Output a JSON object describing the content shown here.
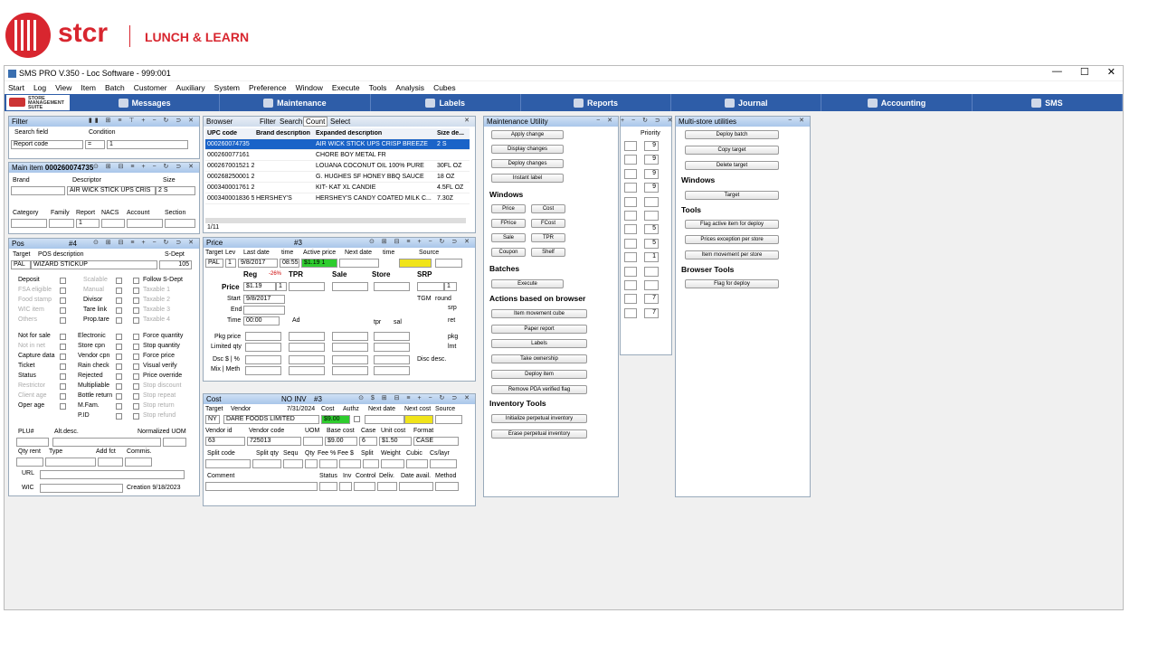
{
  "brand": {
    "name": "stcr",
    "subtitle": "LUNCH & LEARN"
  },
  "window": {
    "title": "SMS PRO V.350 - Loc Software - 999:001",
    "minimize": "—",
    "maximize": "☐",
    "close": "✕"
  },
  "menu": [
    "Start",
    "Log",
    "View",
    "Item",
    "Batch",
    "Customer",
    "Auxiliary",
    "System",
    "Preference",
    "Window",
    "Execute",
    "Tools",
    "Analysis",
    "Cubes"
  ],
  "nav": {
    "logo": "STORE MANAGEMENT SUITE",
    "items": [
      "Messages",
      "Maintenance",
      "Labels",
      "Reports",
      "Journal",
      "Accounting",
      "SMS"
    ]
  },
  "filter": {
    "title": "Filter",
    "search_field_label": "Search field",
    "condition_label": "Condition",
    "search_field": "Report code",
    "operator": "=",
    "value": "1"
  },
  "main_item": {
    "title": "Main item",
    "upc": "000260074735",
    "brand_label": "Brand",
    "descriptor_label": "Descriptor",
    "size_label": "Size",
    "descriptor": "AIR WICK STICK UPS CRIS",
    "size": "2 S",
    "category_label": "Category",
    "family_label": "Family",
    "report_label": "Report",
    "nacs_label": "NACS",
    "account_label": "Account",
    "section_label": "Section",
    "report": "1"
  },
  "pos": {
    "title": "Pos",
    "num": "#4",
    "target_label": "Target",
    "posdesc_label": "POS description",
    "sdept_label": "S-Dept",
    "target": "PAL",
    "desc": "WIZARD STICKUP",
    "sdept": "105",
    "left_labels": [
      "Deposit",
      "FSA eligible",
      "Food stamp",
      "WIC item",
      "Others"
    ],
    "mid_labels": [
      "Scalable",
      "Manual",
      "Divisor",
      "Tare link",
      "Prop.tare"
    ],
    "right_labels": [
      "Follow S-Dept",
      "Taxable 1",
      "Taxable 2",
      "Taxable 3",
      "Taxable 4"
    ],
    "b_left": [
      "Not for sale",
      "Not in net",
      "Capture data",
      "Ticket",
      "Status",
      "Restrictor",
      "Client age",
      "Oper age"
    ],
    "b_mid": [
      "Electronic",
      "Store cpn",
      "Vendor cpn",
      "Rain check",
      "Rejected",
      "Multipliable",
      "Bottle return",
      "M.Fam.",
      "P.ID"
    ],
    "b_right": [
      "Force quantity",
      "Stop quantity",
      "Force price",
      "Visual verify",
      "Price override",
      "Stop discount",
      "Stop repeat",
      "Stop return",
      "Stop refund"
    ],
    "plu_label": "PLU#",
    "altdesc_label": "Alt.desc.",
    "normuom_label": "Normalized UOM",
    "qtyrent_label": "Qty rent",
    "type_label": "Type",
    "addfct_label": "Add fct",
    "commis_label": "Commis.",
    "url_label": "URL",
    "wic_label": "WIC",
    "creation": "Creation 9/18/2023"
  },
  "browser": {
    "title": "Browser",
    "filter": "Filter",
    "search": "Search",
    "count": "Count",
    "select": "Select",
    "cols": [
      "UPC code",
      "Brand description",
      "Expanded description",
      "Size de..."
    ],
    "rows": [
      [
        "000260074735",
        "",
        "AIR WICK STICK UPS CRISP BREEZE",
        "2 S"
      ],
      [
        "000260077161",
        "",
        "CHORE BOY METAL FR",
        ""
      ],
      [
        "000267001521 2",
        "",
        "LOUANA COCONUT OIL 100% PURE",
        "30FL OZ"
      ],
      [
        "000268250001 2",
        "",
        "G. HUGHES SF HONEY BBQ SAUCE",
        "18 OZ"
      ],
      [
        "000340001761 2",
        "",
        "KIT- KAT XL CANDIE",
        "4.5FL OZ"
      ],
      [
        "000340001836 5",
        "HERSHEY'S",
        "HERSHEY'S CANDY COATED MILK C...",
        "7.30Z"
      ]
    ],
    "page": "1/11"
  },
  "price": {
    "title": "Price",
    "num": "#3",
    "hdr": [
      "Target",
      "Lev",
      "Last date",
      "time",
      "Active price",
      "Next date",
      "time",
      "Source"
    ],
    "target": "PAL",
    "lev": "1",
    "last_date": "9/8/2017",
    "time": "08:55",
    "active": "$1.19 1",
    "reg_label": "Reg",
    "pct": "-26%",
    "tpr_label": "TPR",
    "sale_label": "Sale",
    "store_label": "Store",
    "srp_label": "SRP",
    "price_label": "Price",
    "price": "$1.19",
    "qty": "1",
    "srp_qty": "1",
    "start_label": "Start",
    "start": "9/8/2017",
    "end_label": "End",
    "time_label": "Time",
    "time_val": "00:00",
    "ad_label": "Ad",
    "tgm_label": "TGM",
    "round_label": "round",
    "srp_short": "srp",
    "ret_label": "ret",
    "tpr_short": "tpr",
    "sal_short": "sal",
    "pkg_price_label": "Pkg price",
    "limited_label": "Limited qty",
    "pkg_label": "pkg",
    "lmt_label": "lmt",
    "dsc_label": "Dsc $ | %",
    "mix_label": "Mix | Meth",
    "disc_desc_label": "Disc desc."
  },
  "cost": {
    "title": "Cost",
    "noinv": "NO INV",
    "num": "#3",
    "hdr": [
      "Target",
      "Vendor",
      "7/31/2024",
      "Cost",
      "Authz",
      "Next date",
      "Next cost",
      "Source"
    ],
    "target": "NY",
    "vendor": "DARE FOODS LIMITED",
    "cost": "$9.00",
    "vendor_id_label": "Vendor id",
    "vendor_code_label": "Vendor code",
    "uom_label": "UOM",
    "base_cost_label": "Base cost",
    "case_label": "Case",
    "unit_cost_label": "Unit cost",
    "format_label": "Format",
    "vendor_id": "63",
    "vendor_code": "725013",
    "base_cost": "$9.00",
    "case": "6",
    "unit_cost": "$1.50",
    "format": "CASE",
    "split_hdr": [
      "Split code",
      "Split qty",
      "Sequ",
      "Qty",
      "Fee %",
      "Fee $",
      "Split",
      "Weight",
      "Cubic",
      "Cs/layr"
    ],
    "comment_label": "Comment",
    "status_hdr": [
      "Status",
      "Inv",
      "Control",
      "Deliv.",
      "Date avail.",
      "Method"
    ]
  },
  "maint": {
    "title": "Maintenance Utility",
    "b1": [
      "Apply change",
      "Display changes",
      "Deploy changes",
      "Instant label"
    ],
    "windows_label": "Windows",
    "win": [
      [
        "Price",
        "Cost"
      ],
      [
        "FPrice",
        "FCost"
      ],
      [
        "Sale",
        "TPR"
      ],
      [
        "Coupon",
        "Shelf"
      ]
    ],
    "batches_label": "Batches",
    "execute": "Execute",
    "actions_label": "Actions based on browser",
    "actions": [
      "Item movement cube",
      "Paper report",
      "Labels",
      "Take ownership",
      "Deploy item",
      "Remove PDA verified flag"
    ],
    "inv_label": "Inventory Tools",
    "inv": [
      "Initialize perpetual inventory",
      "Erase perpetual inventory"
    ]
  },
  "priority": {
    "label": "Priority",
    "values": [
      "9",
      "9",
      "9",
      "9",
      "",
      "",
      "5",
      "5",
      "1",
      "",
      "",
      "7",
      "7"
    ]
  },
  "multi": {
    "title": "Multi-store utilities",
    "b1": [
      "Deploy batch",
      "Copy target",
      "Delete target"
    ],
    "windows_label": "Windows",
    "target": "Target",
    "tools_label": "Tools",
    "tools": [
      "Flag active item for deploy",
      "Prices exception per store",
      "Item movement per store"
    ],
    "browser_tools_label": "Browser Tools",
    "flag": "Flag for deploy"
  }
}
